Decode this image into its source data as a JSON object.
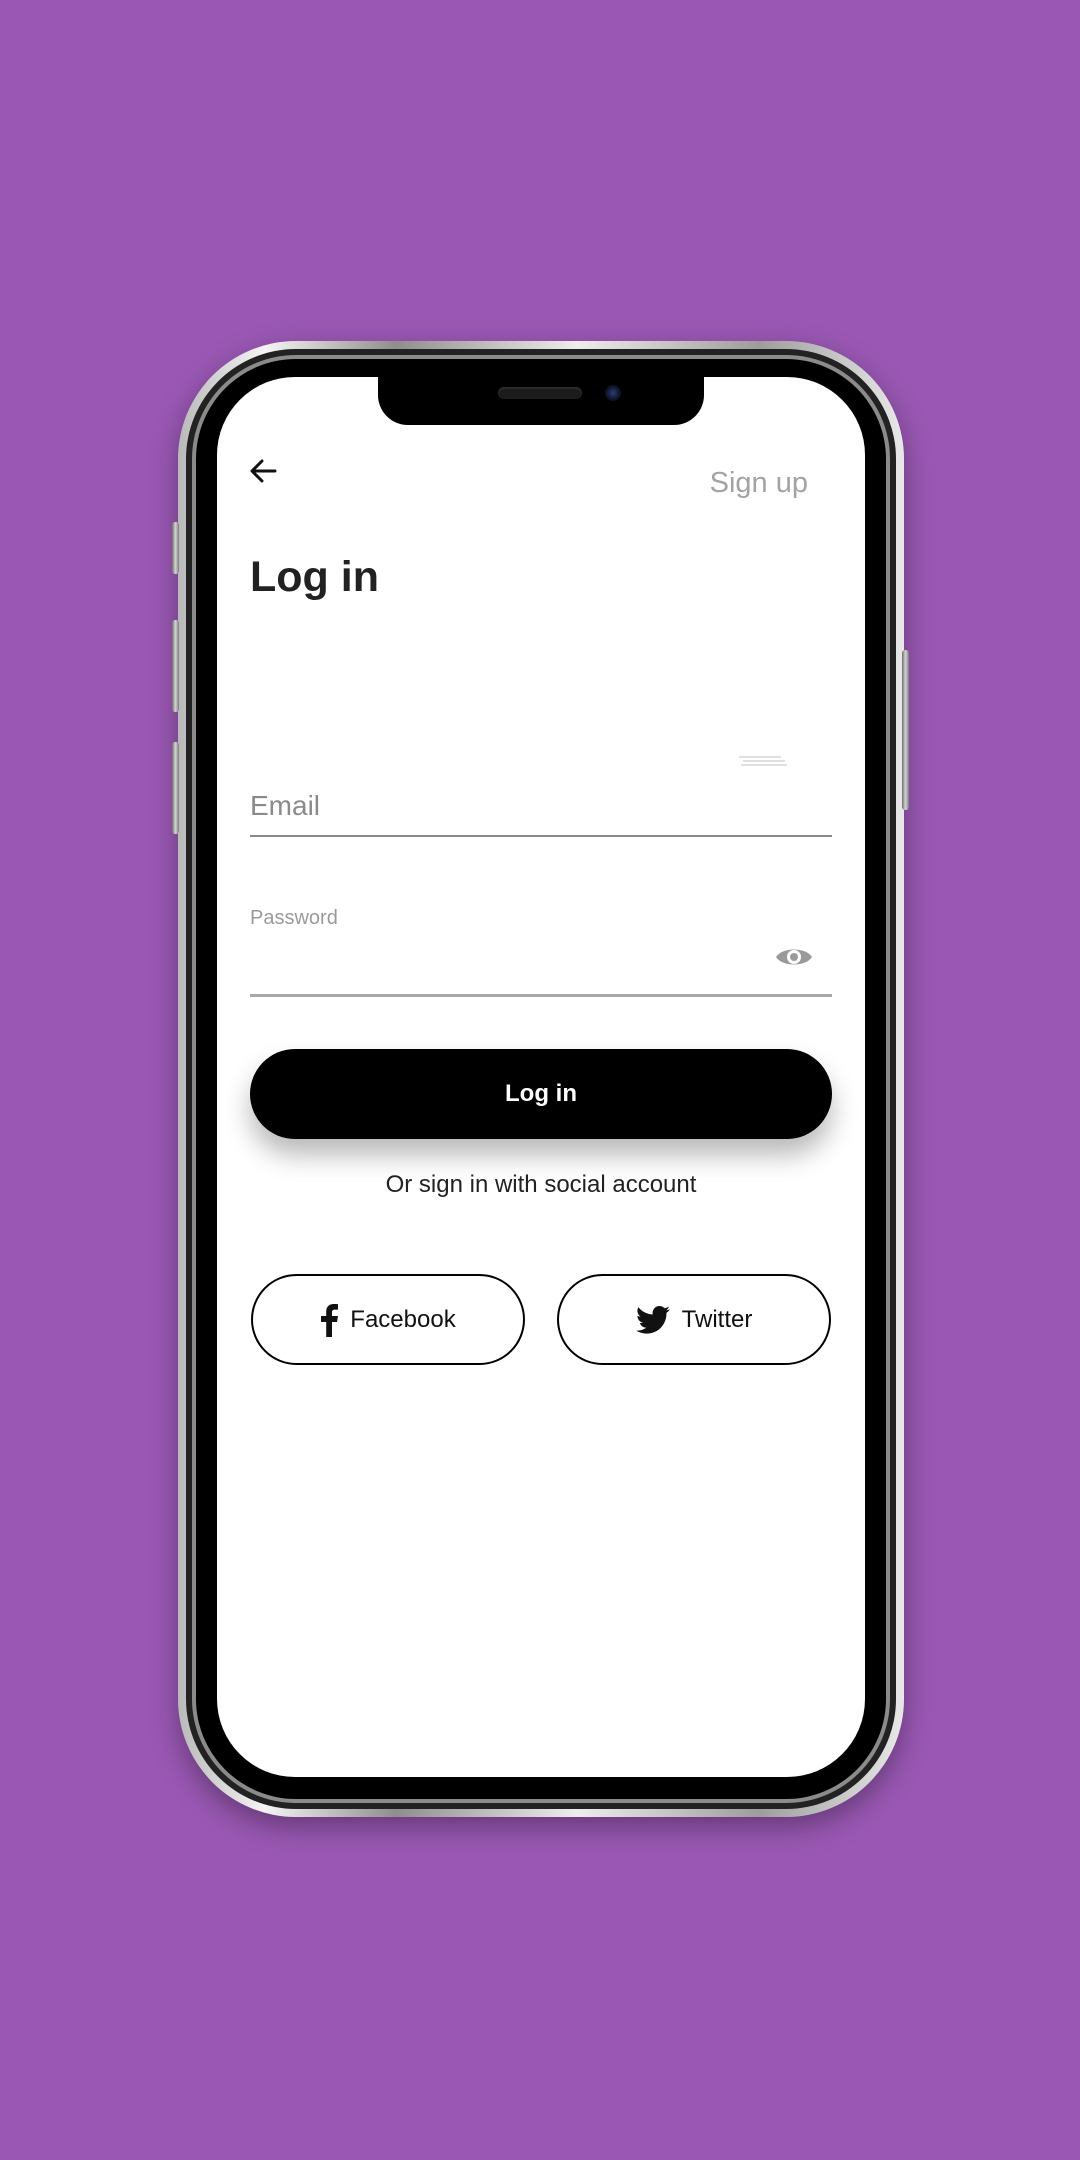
{
  "header": {
    "back_icon": "arrow-left-icon",
    "signup_label": "Sign up"
  },
  "page": {
    "title": "Log in"
  },
  "form": {
    "email_placeholder": "Email",
    "password_label": "Password",
    "eye_icon": "eye-icon",
    "login_button_label": "Log in"
  },
  "social": {
    "caption": "Or sign in with social account",
    "facebook_label": "Facebook",
    "twitter_label": "Twitter"
  },
  "colors": {
    "background": "#9a58b4",
    "primary_button": "#000000",
    "muted_text": "#a3a3a3"
  }
}
